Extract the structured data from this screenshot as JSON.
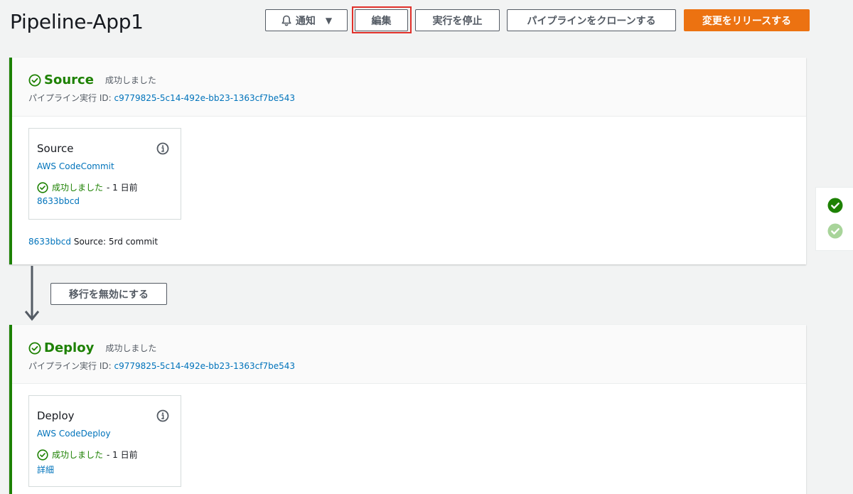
{
  "header": {
    "title": "Pipeline-App1",
    "notify_label": "通知",
    "edit_label": "編集",
    "stop_label": "実行を停止",
    "clone_label": "パイプラインをクローンする",
    "release_label": "変更をリリースする"
  },
  "stages": [
    {
      "name": "Source",
      "status": "成功しました",
      "exec_label": "パイプライン実行 ID:",
      "exec_id": "c9779825-5c14-492e-bb23-1363cf7be543",
      "action": {
        "title": "Source",
        "provider": "AWS CodeCommit",
        "status": "成功しました",
        "time": "- 1 日前",
        "link": "8633bbcd"
      },
      "commit": {
        "id": "8633bbcd",
        "message": "Source: 5rd commit"
      }
    },
    {
      "name": "Deploy",
      "status": "成功しました",
      "exec_label": "パイプライン実行 ID:",
      "exec_id": "c9779825-5c14-492e-bb23-1363cf7be543",
      "action": {
        "title": "Deploy",
        "provider": "AWS CodeDeploy",
        "status": "成功しました",
        "time": "- 1 日前",
        "link": "詳細"
      }
    }
  ],
  "transition": {
    "label": "移行を無効にする"
  },
  "colors": {
    "success": "#1d8102",
    "success_light": "#a8d49a",
    "link": "#0073bb",
    "primary": "#ec7211",
    "highlight": "#e0302a"
  },
  "icons": [
    "bell-icon",
    "caret-down-icon",
    "check-circle-icon",
    "info-icon",
    "arrow-down-icon"
  ]
}
